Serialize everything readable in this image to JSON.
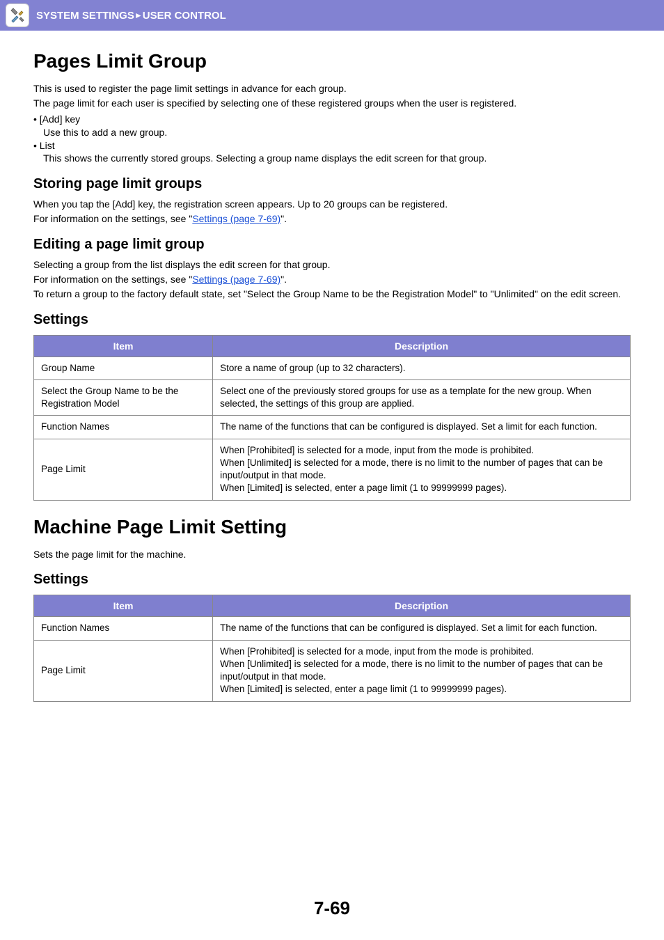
{
  "header": {
    "breadcrumb_part1": "SYSTEM SETTINGS",
    "breadcrumb_sep": "►",
    "breadcrumb_part2": "USER CONTROL",
    "icon": "tools-icon"
  },
  "section1": {
    "title": "Pages Limit Group",
    "intro1": "This is used to register the page limit settings in advance for each group.",
    "intro2": "The page limit for each user is specified by selecting one of these registered groups when the user is registered.",
    "bullets": [
      {
        "label": "• [Add] key",
        "desc": "Use this to add a new group."
      },
      {
        "label": "• List",
        "desc": "This shows the currently stored groups. Selecting a group name displays the edit screen for that group."
      }
    ],
    "sub1": {
      "title": "Storing page limit groups",
      "line1": "When you tap the [Add] key, the registration screen appears. Up to 20 groups can be registered.",
      "line2_pre": "For information on the settings, see \"",
      "line2_link": "Settings (page 7-69)",
      "line2_post": "\"."
    },
    "sub2": {
      "title": "Editing a page limit group",
      "line1": "Selecting a group from the list displays the edit screen for that group.",
      "line2_pre": "For information on the settings, see \"",
      "line2_link": "Settings (page 7-69)",
      "line2_post": "\".",
      "line3": "To return a group to the factory default state, set \"Select the Group Name to be the Registration Model\" to \"Unlimited\" on the edit screen."
    },
    "sub3": {
      "title": "Settings",
      "table": {
        "headers": {
          "item": "Item",
          "desc": "Description"
        },
        "rows": [
          {
            "item": "Group Name",
            "desc": "Store a name of group (up to 32 characters)."
          },
          {
            "item": "Select the Group Name to be the Registration Model",
            "desc": "Select one of the previously stored groups for use as a template for the new group. When selected, the settings of this group are applied."
          },
          {
            "item": "Function Names",
            "desc": "The name of the functions that can be configured is displayed. Set a limit for each function."
          },
          {
            "item": "Page Limit",
            "desc": "When [Prohibited] is selected for a mode, input from the mode is prohibited.\nWhen [Unlimited] is selected for a mode, there is no limit to the number of pages that can be input/output in that mode.\nWhen [Limited] is selected, enter a page limit (1 to 99999999 pages)."
          }
        ]
      }
    }
  },
  "section2": {
    "title": "Machine Page Limit Setting",
    "intro": "Sets the page limit for the machine.",
    "sub": {
      "title": "Settings",
      "table": {
        "headers": {
          "item": "Item",
          "desc": "Description"
        },
        "rows": [
          {
            "item": "Function Names",
            "desc": "The name of the functions that can be configured is displayed. Set a limit for each function."
          },
          {
            "item": "Page Limit",
            "desc": "When [Prohibited] is selected for a mode, input from the mode is prohibited.\nWhen [Unlimited] is selected for a mode, there is no limit to the number of pages that can be input/output in that mode.\nWhen [Limited] is selected, enter a page limit (1 to 99999999 pages)."
          }
        ]
      }
    }
  },
  "page_number": "7-69"
}
